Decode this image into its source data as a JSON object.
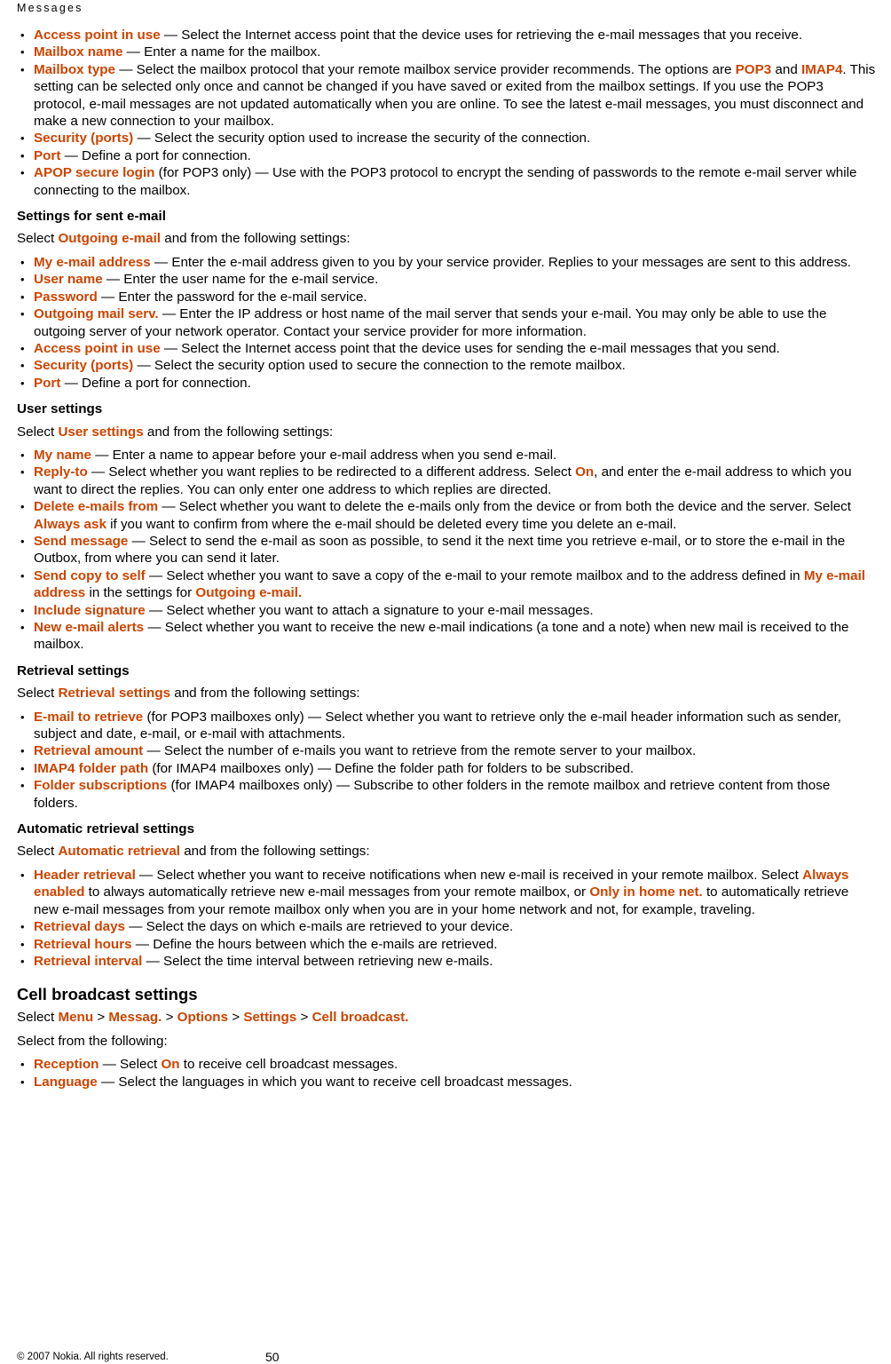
{
  "header": {
    "title": "Messages"
  },
  "footer": {
    "copyright": "© 2007 Nokia. All rights reserved.",
    "page_number": "50"
  },
  "bullets_top": [
    {
      "term": "Access point in use",
      "rest": " — Select the Internet access point that the device uses for retrieving the e-mail messages that you receive."
    },
    {
      "term": "Mailbox name",
      "rest": " — Enter a name for the mailbox."
    },
    {
      "term": "Mailbox type",
      "rest_a": " — Select the mailbox protocol that your remote mailbox service provider recommends. The options are ",
      "link_a": "POP3",
      "rest_b": " and ",
      "link_b": "IMAP4",
      "rest_c": ". This setting can be selected only once and cannot be changed if you have saved or exited from the mailbox settings. If you use the POP3 protocol, e-mail messages are not updated automatically when you are online. To see the latest e-mail messages, you must disconnect and make a new connection to your mailbox."
    },
    {
      "term": "Security (ports)",
      "rest": " — Select the security option used to increase the security of the connection."
    },
    {
      "term": "Port",
      "rest": " — Define a port for connection."
    },
    {
      "term": "APOP secure login",
      "rest": " (for POP3 only) — Use with the POP3 protocol to encrypt the sending of passwords to the remote e-mail server while connecting to the mailbox."
    }
  ],
  "sent": {
    "heading": "Settings for sent e-mail",
    "intro_a": "Select ",
    "intro_link": "Outgoing e-mail",
    "intro_b": " and from the following settings:",
    "bullets": [
      {
        "term": "My e-mail address",
        "rest": " — Enter the e-mail address given to you by your service provider. Replies to your messages are sent to this address."
      },
      {
        "term": "User name",
        "rest": " — Enter the user name for the e-mail service."
      },
      {
        "term": "Password",
        "rest": " — Enter the password for the e-mail service."
      },
      {
        "term": "Outgoing mail serv.",
        "rest": " — Enter the IP address or host name of the mail server that sends your e-mail. You may only be able to use the outgoing server of your network operator. Contact your service provider for more information."
      },
      {
        "term": "Access point in use",
        "rest": " — Select the Internet access point that the device uses for sending the e-mail messages that you send."
      },
      {
        "term": "Security (ports)",
        "rest": " — Select the security option used to secure the connection to the remote mailbox."
      },
      {
        "term": "Port",
        "rest": " — Define a port for connection."
      }
    ]
  },
  "user_settings": {
    "heading": "User settings",
    "intro_a": "Select ",
    "intro_link": "User settings",
    "intro_b": " and from the following settings:",
    "bullets": [
      {
        "term": "My name",
        "rest": " — Enter a name to appear before your e-mail address when you send e-mail."
      },
      {
        "term": "Reply-to",
        "rest_a": " — Select whether you want replies to be redirected to a different address. Select ",
        "link_a": "On",
        "rest_b": ", and enter the e-mail address to which you want to direct the replies. You can only enter one address to which replies are directed."
      },
      {
        "term": "Delete e-mails from",
        "rest_a": " — Select whether you want to delete the e-mails only from the device or from both the device and the server. Select ",
        "link_a": "Always ask",
        "rest_b": " if you want to confirm from where the e-mail should be deleted every time you delete an e-mail."
      },
      {
        "term": "Send message",
        "rest": " — Select to send the e-mail as soon as possible, to send it the next time you retrieve e-mail, or to store the e-mail in the Outbox, from where you can send it later."
      },
      {
        "term": "Send copy to self",
        "rest_a": " — Select whether you want to save a copy of the e-mail to your remote mailbox and to the address defined in ",
        "link_a": "My e-mail address",
        "rest_b": " in the settings for ",
        "link_b": "Outgoing e-mail.",
        "rest_c": ""
      },
      {
        "term": "Include signature",
        "rest": " — Select whether you want to attach a signature to your e-mail messages."
      },
      {
        "term": "New e-mail alerts",
        "rest": " — Select whether you want to receive the new e-mail indications (a tone and a note) when new mail is received to the mailbox."
      }
    ]
  },
  "retrieval": {
    "heading": "Retrieval settings",
    "intro_a": "Select ",
    "intro_link": "Retrieval settings",
    "intro_b": " and from the following settings:",
    "bullets": [
      {
        "term": "E-mail to retrieve",
        "rest": " (for POP3 mailboxes only) — Select whether you want to retrieve only the e-mail header information such as sender, subject and date, e-mail, or e-mail with attachments."
      },
      {
        "term": "Retrieval amount",
        "rest": " — Select the number of e-mails you want to retrieve from the remote server to your mailbox."
      },
      {
        "term": "IMAP4 folder path",
        "rest": " (for IMAP4 mailboxes only) — Define the folder path for folders to be subscribed."
      },
      {
        "term": "Folder subscriptions",
        "rest": " (for IMAP4 mailboxes only) — Subscribe to other folders in the remote mailbox and retrieve content from those folders."
      }
    ]
  },
  "auto_retrieval": {
    "heading": "Automatic retrieval settings",
    "intro_a": "Select ",
    "intro_link": "Automatic retrieval",
    "intro_b": " and from the following settings:",
    "bullets": [
      {
        "term": "Header retrieval",
        "rest_a": " — Select whether you want to receive notifications when new e-mail is received in your remote mailbox. Select ",
        "link_a": "Always enabled",
        "rest_b": " to always automatically retrieve new e-mail messages from your remote mailbox, or ",
        "link_b": "Only in home net.",
        "rest_c": " to automatically retrieve new e-mail messages from your remote mailbox only when you are in your home network and not, for example, traveling."
      },
      {
        "term": "Retrieval days",
        "rest": " — Select the days on which e-mails are retrieved to your device."
      },
      {
        "term": "Retrieval hours",
        "rest": " — Define the hours between which the e-mails are retrieved."
      },
      {
        "term": "Retrieval interval",
        "rest": " — Select the time interval between retrieving new e-mails."
      }
    ]
  },
  "cell_broadcast": {
    "heading": "Cell broadcast settings",
    "path_prefix": "Select ",
    "path": [
      "Menu",
      "Messag.",
      "Options",
      "Settings",
      "Cell broadcast."
    ],
    "sep": " > ",
    "intro": "Select from the following:",
    "bullets": [
      {
        "term": "Reception",
        "rest_a": " — Select ",
        "link_a": "On",
        "rest_b": " to receive cell broadcast messages."
      },
      {
        "term": "Language",
        "rest": " — Select the languages in which you want to receive cell broadcast messages."
      }
    ]
  }
}
